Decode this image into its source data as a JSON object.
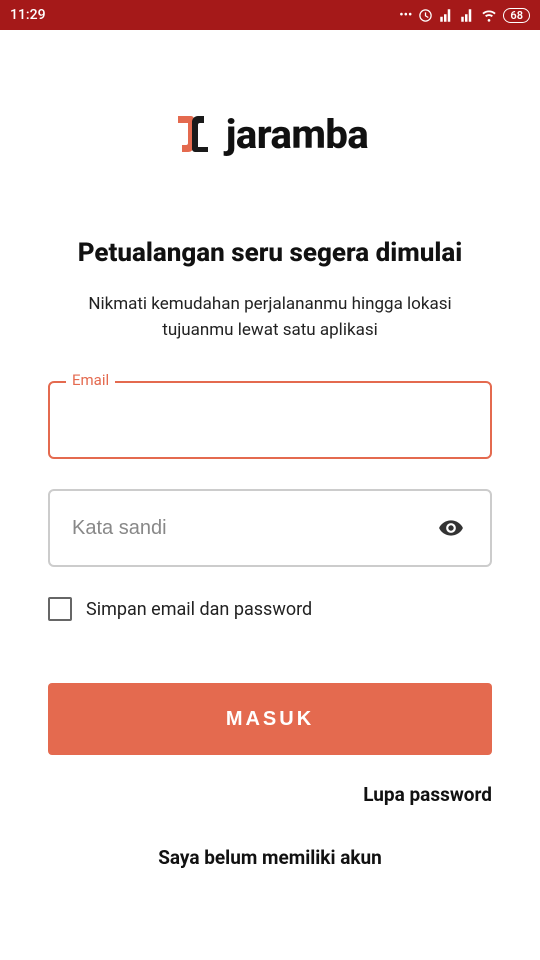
{
  "status": {
    "time": "11:29",
    "battery": "68"
  },
  "brand": {
    "name": "jaramba"
  },
  "headline": "Petualangan seru segera dimulai",
  "subtext": "Nikmati kemudahan perjalananmu hingga lokasi tujuanmu lewat satu aplikasi",
  "form": {
    "email_label": "Email",
    "email_value": "",
    "password_placeholder": "Kata sandi",
    "password_value": "",
    "remember_label": "Simpan email dan password"
  },
  "buttons": {
    "login": "MASUK",
    "forgot": "Lupa password",
    "no_account": "Saya belum memiliki akun"
  }
}
